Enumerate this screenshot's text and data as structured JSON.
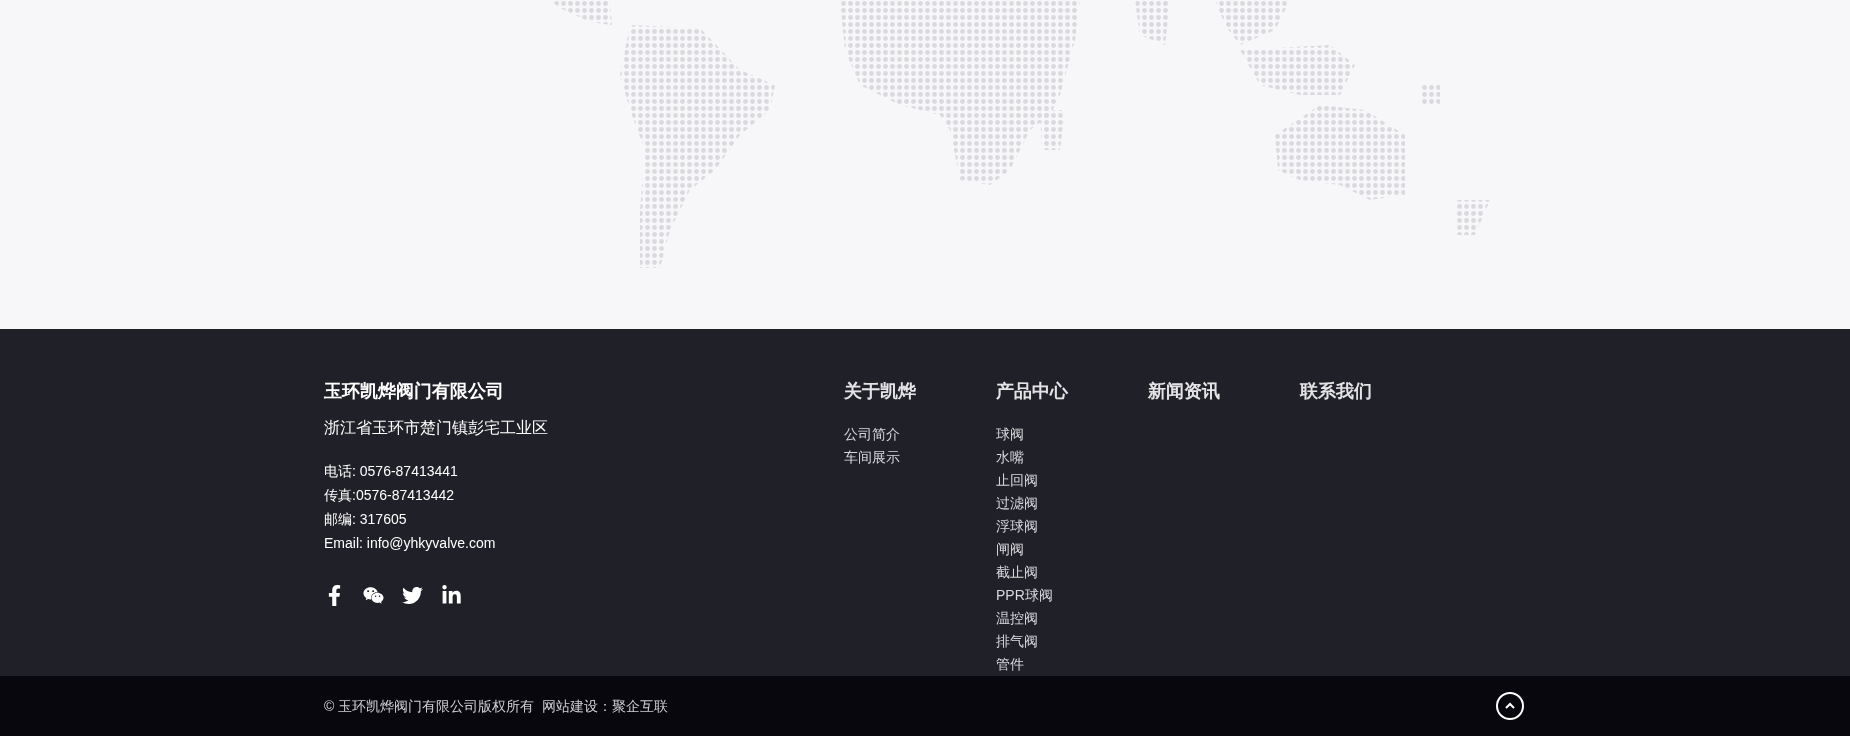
{
  "company": {
    "name": "玉环凯烨阀门有限公司",
    "address": "浙江省玉环市楚门镇彭宅工业区",
    "contacts": [
      "电话: 0576-87413441",
      "传真:0576-87413442",
      "邮编: 317605",
      "Email: info@yhkyvalve.com"
    ],
    "social": [
      {
        "kind": "facebook"
      },
      {
        "kind": "wechat"
      },
      {
        "kind": "twitter"
      },
      {
        "kind": "linkedin"
      }
    ]
  },
  "columns": [
    {
      "title": "关于凯烨",
      "items": [
        "公司简介",
        "车间展示"
      ]
    },
    {
      "title": "产品中心",
      "items": [
        "球阀",
        "水嘴",
        "止回阀",
        "过滤阀",
        "浮球阀",
        "闸阀",
        "截止阀",
        "PPR球阀",
        "温控阀",
        "排气阀",
        "管件"
      ]
    },
    {
      "title": "新闻资讯"
    },
    {
      "title": "联系我们"
    }
  ],
  "bottom_bar": {
    "copyright": "© 玉环凯烨阀门有限公司版权所有",
    "credit": "网站建设：聚企互联"
  }
}
